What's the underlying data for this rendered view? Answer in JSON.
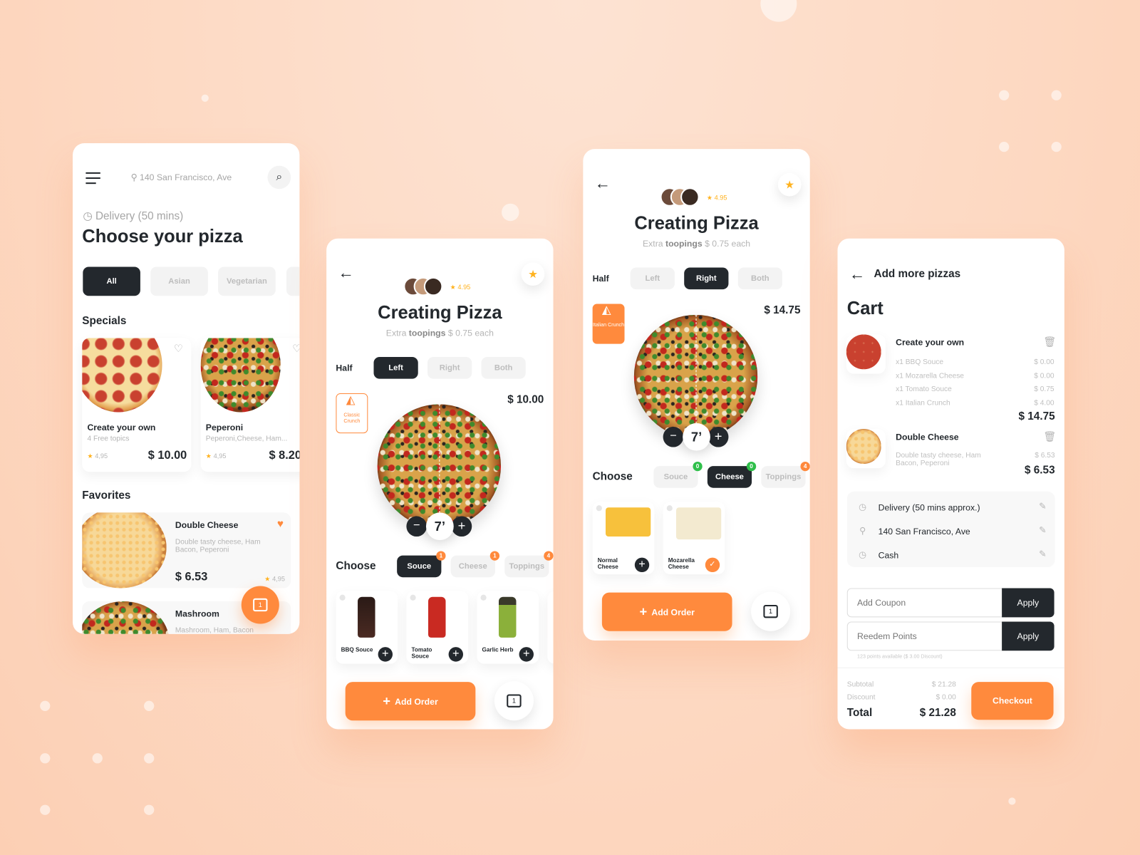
{
  "colors": {
    "background": "#fdd9c2",
    "accent": "#ff8a3d",
    "dark": "#23282d",
    "badge_green": "#2fbf4a"
  },
  "browse": {
    "location": "140 San Francisco, Ave",
    "delivery": "Delivery (50 mins)",
    "title": "Choose your pizza",
    "categories": [
      "All",
      "Asian",
      "Vegetarian"
    ],
    "specials_heading": "Specials",
    "specials": [
      {
        "name": "Create your own",
        "subtitle": "4 Free topics",
        "rating": "4,95",
        "price": "$ 10.00"
      },
      {
        "name": "Peperoni",
        "subtitle": "Peperoni,Cheese, Ham...",
        "rating": "4,95",
        "price": "$ 8.20"
      }
    ],
    "favorites_heading": "Favorites",
    "favorites": [
      {
        "name": "Double Cheese",
        "desc": "Double tasty cheese, Ham Bacon, Peperoni",
        "price": "$ 6.53",
        "rating": "4,95"
      },
      {
        "name": "Mashroom",
        "desc": "Mashroom, Ham, Bacon"
      }
    ],
    "cart_count": "1"
  },
  "create_left": {
    "rating": "4.95",
    "title": "Creating Pizza",
    "subtitle_pre": "Extra ",
    "subtitle_bold": "toopings",
    "subtitle_post": " $ 0.75 each",
    "half_label": "Half",
    "halves": [
      "Left",
      "Right",
      "Both"
    ],
    "selected_half": "Left",
    "crust": "Classic Crunch",
    "price": "$ 10.00",
    "size": "7’",
    "choose_label": "Choose",
    "tabs": [
      {
        "label": "Souce",
        "count": "1"
      },
      {
        "label": "Cheese",
        "count": "1"
      },
      {
        "label": "Toppings",
        "count": "4"
      }
    ],
    "products": [
      "BBQ Souce",
      "Tomato Souce",
      "Garlic Herb"
    ],
    "add_order": "Add Order",
    "cart_count": "1"
  },
  "create_right": {
    "rating": "4.95",
    "title": "Creating Pizza",
    "subtitle_pre": "Extra ",
    "subtitle_bold": "toopings",
    "subtitle_post": " $ 0.75 each",
    "half_label": "Half",
    "halves": [
      "Left",
      "Right",
      "Both"
    ],
    "selected_half": "Right",
    "crust": "Italian Crunch",
    "price": "$ 14.75",
    "size": "7’",
    "choose_label": "Choose",
    "tabs": [
      {
        "label": "Souce",
        "count": "0"
      },
      {
        "label": "Cheese",
        "count": "0"
      },
      {
        "label": "Toppings",
        "count": "4"
      }
    ],
    "products": [
      "Normal Cheese",
      "Mozarella Cheese"
    ],
    "add_order": "Add Order",
    "cart_count": "1"
  },
  "cart": {
    "back_label": "Add more pizzas",
    "title": "Cart",
    "items": [
      {
        "name": "Create your own",
        "lines": [
          {
            "label": "x1 BBQ Souce",
            "price": "$ 0.00"
          },
          {
            "label": "x1 Mozarella Cheese",
            "price": "$ 0.00"
          },
          {
            "label": "x1 Tomato Souce",
            "price": "$ 0.75"
          },
          {
            "label": "x1 Italian Crunch",
            "price": "$ 4.00"
          }
        ],
        "total": "$ 14.75"
      },
      {
        "name": "Double Cheese",
        "desc": "Double tasty cheese, Ham Bacon, Peperoni",
        "price": "$ 6.53",
        "total": "$ 6.53"
      }
    ],
    "delivery": "Delivery (50 mins approx.)",
    "address": "140 San Francisco, Ave",
    "payment": "Cash",
    "coupon_placeholder": "Add Coupon",
    "points_placeholder": "Reedem Points",
    "apply": "Apply",
    "points_note": "123 points available ($ 3.00 Discount)",
    "subtotal_label": "Subtotal",
    "subtotal": "$ 21.28",
    "discount_label": "Discount",
    "discount": "$ 0.00",
    "total_label": "Total",
    "total": "$ 21.28",
    "checkout": "Checkout"
  }
}
